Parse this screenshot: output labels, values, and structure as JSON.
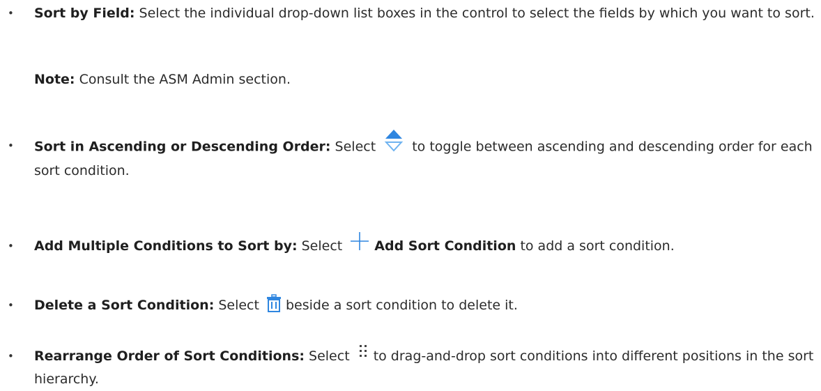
{
  "items": [
    {
      "title": "Sort by Field:",
      "text": " Select the individual drop-down list boxes in the control to select the fields by which you want to sort."
    },
    {
      "title": "Sort in Ascending or Descending Order:",
      "text_before": " Select",
      "text_after": "to toggle between ascending and descending order for each sort condition.",
      "icon": "sort-toggle-icon"
    },
    {
      "title": "Add Multiple Conditions to Sort by:",
      "text_before": " Select",
      "button_label": "Add Sort Condition",
      "text_after": " to add a sort condition.",
      "icon": "plus-icon"
    },
    {
      "title": "Delete a Sort Condition:",
      "text_before": " Select",
      "text_after": "beside a sort condition to delete it.",
      "icon": "trash-icon"
    },
    {
      "title": "Rearrange Order of Sort Conditions:",
      "text_before": " Select",
      "text_after": "to drag-and-drop sort conditions into different positions in the sort hierarchy.",
      "icon": "drag-handle-icon"
    }
  ],
  "note": {
    "label": "Note:",
    "text": " Consult the ASM Admin section."
  },
  "bullet_char": "•",
  "colors": {
    "icon_blue": "#2f86e0",
    "icon_light_blue": "#6fb3f0",
    "text": "#2b2b2b"
  }
}
